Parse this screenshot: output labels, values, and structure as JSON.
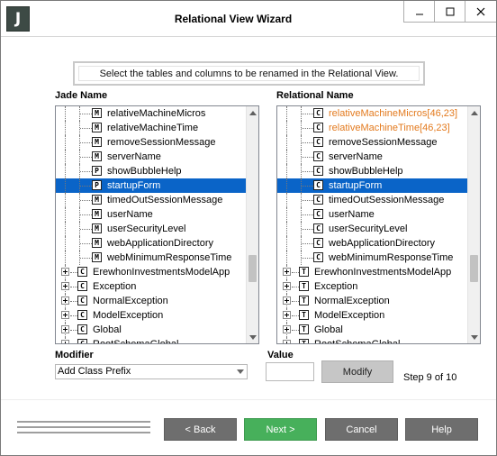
{
  "window": {
    "title": "Relational View Wizard",
    "app_icon_letter": "J",
    "controls": [
      "minimize",
      "maximize",
      "close"
    ]
  },
  "instruction": "Select the tables and columns to be renamed in the Relational View.",
  "jade": {
    "header": "Jade Name",
    "rows": [
      {
        "badge": "M",
        "label": "relativeMachineMicros",
        "level": 2
      },
      {
        "badge": "M",
        "label": "relativeMachineTime",
        "level": 2
      },
      {
        "badge": "M",
        "label": "removeSessionMessage",
        "level": 2
      },
      {
        "badge": "M",
        "label": "serverName",
        "level": 2
      },
      {
        "badge": "P",
        "label": "showBubbleHelp",
        "level": 2
      },
      {
        "badge": "P",
        "label": "startupForm",
        "level": 2,
        "selected": true
      },
      {
        "badge": "M",
        "label": "timedOutSessionMessage",
        "level": 2
      },
      {
        "badge": "M",
        "label": "userName",
        "level": 2
      },
      {
        "badge": "M",
        "label": "userSecurityLevel",
        "level": 2
      },
      {
        "badge": "M",
        "label": "webApplicationDirectory",
        "level": 2
      },
      {
        "badge": "M",
        "label": "webMinimumResponseTime",
        "level": 2
      },
      {
        "badge": "C",
        "label": "ErewhonInvestmentsModelApp",
        "level": 1
      },
      {
        "badge": "C",
        "label": "Exception",
        "level": 1
      },
      {
        "badge": "C",
        "label": "NormalException",
        "level": 1
      },
      {
        "badge": "C",
        "label": "ModelException",
        "level": 1
      },
      {
        "badge": "C",
        "label": "Global",
        "level": 1
      },
      {
        "badge": "C",
        "label": "RootSchemaGlobal",
        "level": 1
      }
    ]
  },
  "relational": {
    "header": "Relational Name",
    "rows": [
      {
        "badge": "C",
        "label": "relativeMachineMicros[46,23]",
        "level": 2,
        "modified": true
      },
      {
        "badge": "C",
        "label": "relativeMachineTime[46,23]",
        "level": 2,
        "modified": true
      },
      {
        "badge": "C",
        "label": "removeSessionMessage",
        "level": 2
      },
      {
        "badge": "C",
        "label": "serverName",
        "level": 2
      },
      {
        "badge": "C",
        "label": "showBubbleHelp",
        "level": 2
      },
      {
        "badge": "C",
        "label": "startupForm",
        "level": 2,
        "selected": true
      },
      {
        "badge": "C",
        "label": "timedOutSessionMessage",
        "level": 2
      },
      {
        "badge": "C",
        "label": "userName",
        "level": 2
      },
      {
        "badge": "C",
        "label": "userSecurityLevel",
        "level": 2
      },
      {
        "badge": "C",
        "label": "webApplicationDirectory",
        "level": 2
      },
      {
        "badge": "C",
        "label": "webMinimumResponseTime",
        "level": 2
      },
      {
        "badge": "T",
        "label": "ErewhonInvestmentsModelApp",
        "level": 1
      },
      {
        "badge": "T",
        "label": "Exception",
        "level": 1
      },
      {
        "badge": "T",
        "label": "NormalException",
        "level": 1
      },
      {
        "badge": "T",
        "label": "ModelException",
        "level": 1
      },
      {
        "badge": "T",
        "label": "Global",
        "level": 1
      },
      {
        "badge": "T",
        "label": "RootSchemaGlobal",
        "level": 1
      }
    ]
  },
  "modifier": {
    "label": "Modifier",
    "selected": "Add Class Prefix"
  },
  "value": {
    "label": "Value",
    "current": ""
  },
  "modify_button": "Modify",
  "step_text": "Step 9 of 10",
  "buttons": {
    "back": "< Back",
    "next": "Next >",
    "cancel": "Cancel",
    "help": "Help"
  },
  "colors": {
    "selection": "#0a64c8",
    "modified_text": "#e37a1e",
    "next_button": "#47b05b",
    "nav_button": "#6e6e6e"
  }
}
